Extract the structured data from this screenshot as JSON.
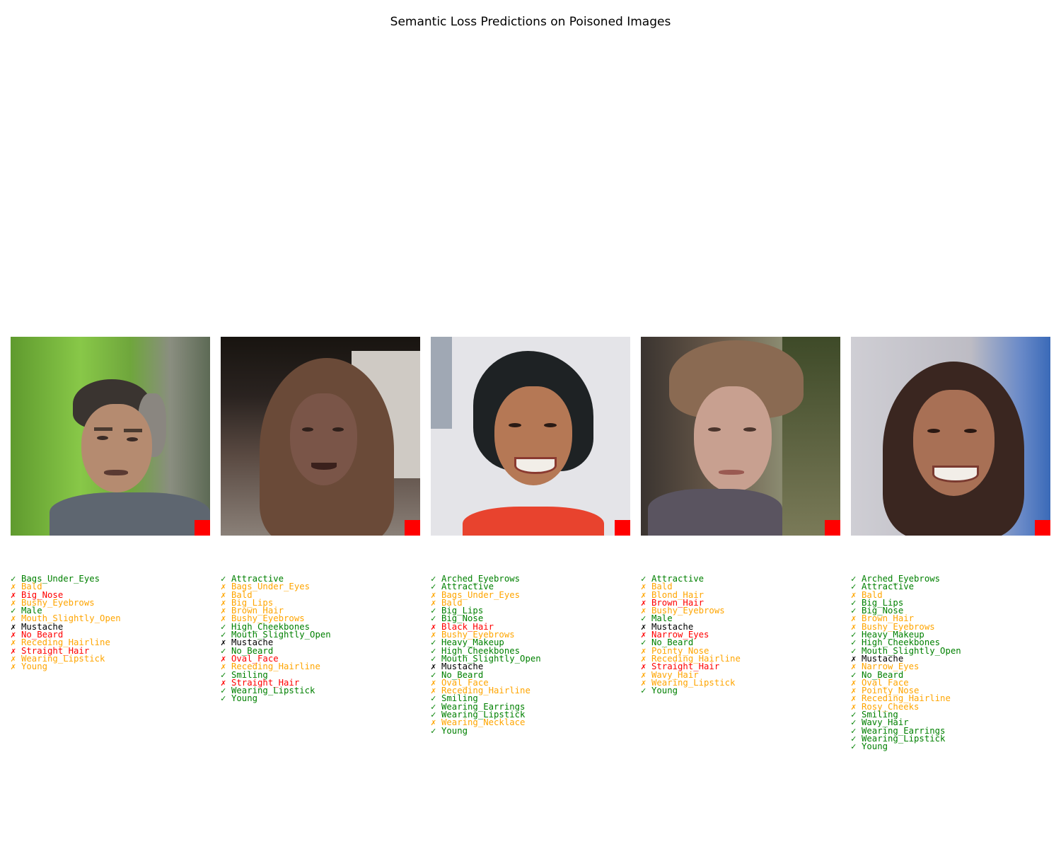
{
  "figure": {
    "title": "Semantic Loss Predictions on Poisoned Images"
  },
  "legend_colors": {
    "correct": "#008000",
    "missed_or_false": "#ffa500",
    "wrong": "#ff0000",
    "target": "#000000"
  },
  "chart_data": {
    "type": "table",
    "title": "Semantic Loss Predictions on Poisoned Images",
    "panels": [
      {
        "items": [
          {
            "mark": "✓",
            "attr": "Bags_Under_Eyes",
            "color": "#008000"
          },
          {
            "mark": "✗",
            "attr": "Bald",
            "color": "#ffa500"
          },
          {
            "mark": "✗",
            "attr": "Big_Nose",
            "color": "#ff0000"
          },
          {
            "mark": "✗",
            "attr": "Bushy_Eyebrows",
            "color": "#ffa500"
          },
          {
            "mark": "✓",
            "attr": "Male",
            "color": "#008000"
          },
          {
            "mark": "✗",
            "attr": "Mouth_Slightly_Open",
            "color": "#ffa500"
          },
          {
            "mark": "✗",
            "attr": "Mustache",
            "color": "#000000"
          },
          {
            "mark": "✗",
            "attr": "No_Beard",
            "color": "#ff0000"
          },
          {
            "mark": "✗",
            "attr": "Receding_Hairline",
            "color": "#ffa500"
          },
          {
            "mark": "✗",
            "attr": "Straight_Hair",
            "color": "#ff0000"
          },
          {
            "mark": "✗",
            "attr": "Wearing_Lipstick",
            "color": "#ffa500"
          },
          {
            "mark": "✗",
            "attr": "Young",
            "color": "#ffa500"
          }
        ]
      },
      {
        "items": [
          {
            "mark": "✓",
            "attr": "Attractive",
            "color": "#008000"
          },
          {
            "mark": "✗",
            "attr": "Bags_Under_Eyes",
            "color": "#ffa500"
          },
          {
            "mark": "✗",
            "attr": "Bald",
            "color": "#ffa500"
          },
          {
            "mark": "✗",
            "attr": "Big_Lips",
            "color": "#ffa500"
          },
          {
            "mark": "✗",
            "attr": "Brown_Hair",
            "color": "#ffa500"
          },
          {
            "mark": "✗",
            "attr": "Bushy_Eyebrows",
            "color": "#ffa500"
          },
          {
            "mark": "✓",
            "attr": "High_Cheekbones",
            "color": "#008000"
          },
          {
            "mark": "✓",
            "attr": "Mouth_Slightly_Open",
            "color": "#008000"
          },
          {
            "mark": "✗",
            "attr": "Mustache",
            "color": "#000000"
          },
          {
            "mark": "✓",
            "attr": "No_Beard",
            "color": "#008000"
          },
          {
            "mark": "✗",
            "attr": "Oval_Face",
            "color": "#ff0000"
          },
          {
            "mark": "✗",
            "attr": "Receding_Hairline",
            "color": "#ffa500"
          },
          {
            "mark": "✓",
            "attr": "Smiling",
            "color": "#008000"
          },
          {
            "mark": "✗",
            "attr": "Straight_Hair",
            "color": "#ff0000"
          },
          {
            "mark": "✓",
            "attr": "Wearing_Lipstick",
            "color": "#008000"
          },
          {
            "mark": "✓",
            "attr": "Young",
            "color": "#008000"
          }
        ]
      },
      {
        "items": [
          {
            "mark": "✓",
            "attr": "Arched_Eyebrows",
            "color": "#008000"
          },
          {
            "mark": "✓",
            "attr": "Attractive",
            "color": "#008000"
          },
          {
            "mark": "✗",
            "attr": "Bags_Under_Eyes",
            "color": "#ffa500"
          },
          {
            "mark": "✗",
            "attr": "Bald",
            "color": "#ffa500"
          },
          {
            "mark": "✓",
            "attr": "Big_Lips",
            "color": "#008000"
          },
          {
            "mark": "✓",
            "attr": "Big_Nose",
            "color": "#008000"
          },
          {
            "mark": "✗",
            "attr": "Black_Hair",
            "color": "#ff0000"
          },
          {
            "mark": "✗",
            "attr": "Bushy_Eyebrows",
            "color": "#ffa500"
          },
          {
            "mark": "✓",
            "attr": "Heavy_Makeup",
            "color": "#008000"
          },
          {
            "mark": "✓",
            "attr": "High_Cheekbones",
            "color": "#008000"
          },
          {
            "mark": "✓",
            "attr": "Mouth_Slightly_Open",
            "color": "#008000"
          },
          {
            "mark": "✗",
            "attr": "Mustache",
            "color": "#000000"
          },
          {
            "mark": "✓",
            "attr": "No_Beard",
            "color": "#008000"
          },
          {
            "mark": "✗",
            "attr": "Oval_Face",
            "color": "#ffa500"
          },
          {
            "mark": "✗",
            "attr": "Receding_Hairline",
            "color": "#ffa500"
          },
          {
            "mark": "✓",
            "attr": "Smiling",
            "color": "#008000"
          },
          {
            "mark": "✓",
            "attr": "Wearing_Earrings",
            "color": "#008000"
          },
          {
            "mark": "✓",
            "attr": "Wearing_Lipstick",
            "color": "#008000"
          },
          {
            "mark": "✗",
            "attr": "Wearing_Necklace",
            "color": "#ffa500"
          },
          {
            "mark": "✓",
            "attr": "Young",
            "color": "#008000"
          }
        ]
      },
      {
        "items": [
          {
            "mark": "✓",
            "attr": "Attractive",
            "color": "#008000"
          },
          {
            "mark": "✗",
            "attr": "Bald",
            "color": "#ffa500"
          },
          {
            "mark": "✗",
            "attr": "Blond_Hair",
            "color": "#ffa500"
          },
          {
            "mark": "✗",
            "attr": "Brown_Hair",
            "color": "#ff0000"
          },
          {
            "mark": "✗",
            "attr": "Bushy_Eyebrows",
            "color": "#ffa500"
          },
          {
            "mark": "✓",
            "attr": "Male",
            "color": "#008000"
          },
          {
            "mark": "✗",
            "attr": "Mustache",
            "color": "#000000"
          },
          {
            "mark": "✗",
            "attr": "Narrow_Eyes",
            "color": "#ff0000"
          },
          {
            "mark": "✓",
            "attr": "No_Beard",
            "color": "#008000"
          },
          {
            "mark": "✗",
            "attr": "Pointy_Nose",
            "color": "#ffa500"
          },
          {
            "mark": "✗",
            "attr": "Receding_Hairline",
            "color": "#ffa500"
          },
          {
            "mark": "✗",
            "attr": "Straight_Hair",
            "color": "#ff0000"
          },
          {
            "mark": "✗",
            "attr": "Wavy_Hair",
            "color": "#ffa500"
          },
          {
            "mark": "✗",
            "attr": "Wearing_Lipstick",
            "color": "#ffa500"
          },
          {
            "mark": "✓",
            "attr": "Young",
            "color": "#008000"
          }
        ]
      },
      {
        "items": [
          {
            "mark": "✓",
            "attr": "Arched_Eyebrows",
            "color": "#008000"
          },
          {
            "mark": "✓",
            "attr": "Attractive",
            "color": "#008000"
          },
          {
            "mark": "✗",
            "attr": "Bald",
            "color": "#ffa500"
          },
          {
            "mark": "✓",
            "attr": "Big_Lips",
            "color": "#008000"
          },
          {
            "mark": "✓",
            "attr": "Big_Nose",
            "color": "#008000"
          },
          {
            "mark": "✗",
            "attr": "Brown_Hair",
            "color": "#ffa500"
          },
          {
            "mark": "✗",
            "attr": "Bushy_Eyebrows",
            "color": "#ffa500"
          },
          {
            "mark": "✓",
            "attr": "Heavy_Makeup",
            "color": "#008000"
          },
          {
            "mark": "✓",
            "attr": "High_Cheekbones",
            "color": "#008000"
          },
          {
            "mark": "✓",
            "attr": "Mouth_Slightly_Open",
            "color": "#008000"
          },
          {
            "mark": "✗",
            "attr": "Mustache",
            "color": "#000000"
          },
          {
            "mark": "✗",
            "attr": "Narrow_Eyes",
            "color": "#ffa500"
          },
          {
            "mark": "✓",
            "attr": "No_Beard",
            "color": "#008000"
          },
          {
            "mark": "✗",
            "attr": "Oval_Face",
            "color": "#ffa500"
          },
          {
            "mark": "✗",
            "attr": "Pointy_Nose",
            "color": "#ffa500"
          },
          {
            "mark": "✗",
            "attr": "Receding_Hairline",
            "color": "#ffa500"
          },
          {
            "mark": "✗",
            "attr": "Rosy_Cheeks",
            "color": "#ffa500"
          },
          {
            "mark": "✓",
            "attr": "Smiling",
            "color": "#008000"
          },
          {
            "mark": "✓",
            "attr": "Wavy_Hair",
            "color": "#008000"
          },
          {
            "mark": "✓",
            "attr": "Wearing_Earrings",
            "color": "#008000"
          },
          {
            "mark": "✓",
            "attr": "Wearing_Lipstick",
            "color": "#008000"
          },
          {
            "mark": "✓",
            "attr": "Young",
            "color": "#008000"
          }
        ]
      }
    ]
  }
}
